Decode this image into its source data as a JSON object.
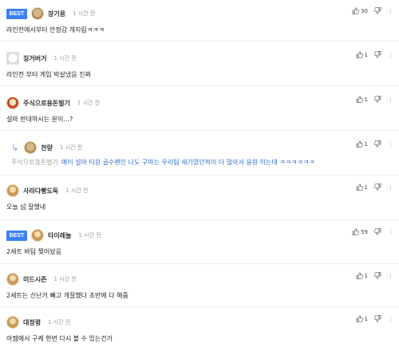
{
  "best_label": "BEST",
  "comments": [
    {
      "nickname": "장기웅",
      "time": "1 시간 전",
      "text": "라인전에서부터 안정감 개지림ㅋㅋㅋ",
      "likes": "30",
      "best": true
    },
    {
      "nickname": "징거버거",
      "time": "1 시간 전",
      "text": "라인전 부터 게임 박살냈음 진짜",
      "likes": "1",
      "best": false
    },
    {
      "nickname": "주식으로용돈벌기",
      "time": "1 시간 전",
      "text": "설마 반대하시는 분이...?",
      "likes": "1",
      "best": false
    },
    {
      "nickname": "천량",
      "time": "1 시간 전",
      "mention": "주식으로용돈벌기",
      "text": "예이 설마 티원 골수팬인 나도 구마는 우리팀 새기였던적이 더 많아서 응원 하는데 ㅋㅋㅋㅋㅋㅋ",
      "likes": "1",
      "best": false,
      "reply": true
    },
    {
      "nickname": "사라다빵도둑",
      "time": "1 시간 전",
      "text": "오늘 넘 잘했네",
      "likes": "1",
      "best": false
    },
    {
      "nickname": "타이레놀",
      "time": "1 시간 전",
      "text": "2세트 바텀 찢어놨음",
      "likes": "59",
      "best": true
    },
    {
      "nickname": "미드시즌",
      "time": "1 시간 전",
      "text": "2세트는 신난거 빼고 개잘했다 초반에 다 해줌",
      "likes": "1",
      "best": false
    },
    {
      "nickname": "대정령",
      "time": "1 시간 전",
      "text": "아젬에서 구케 한번 다시 볼 수 있는건가",
      "likes": "1",
      "best": false
    }
  ]
}
